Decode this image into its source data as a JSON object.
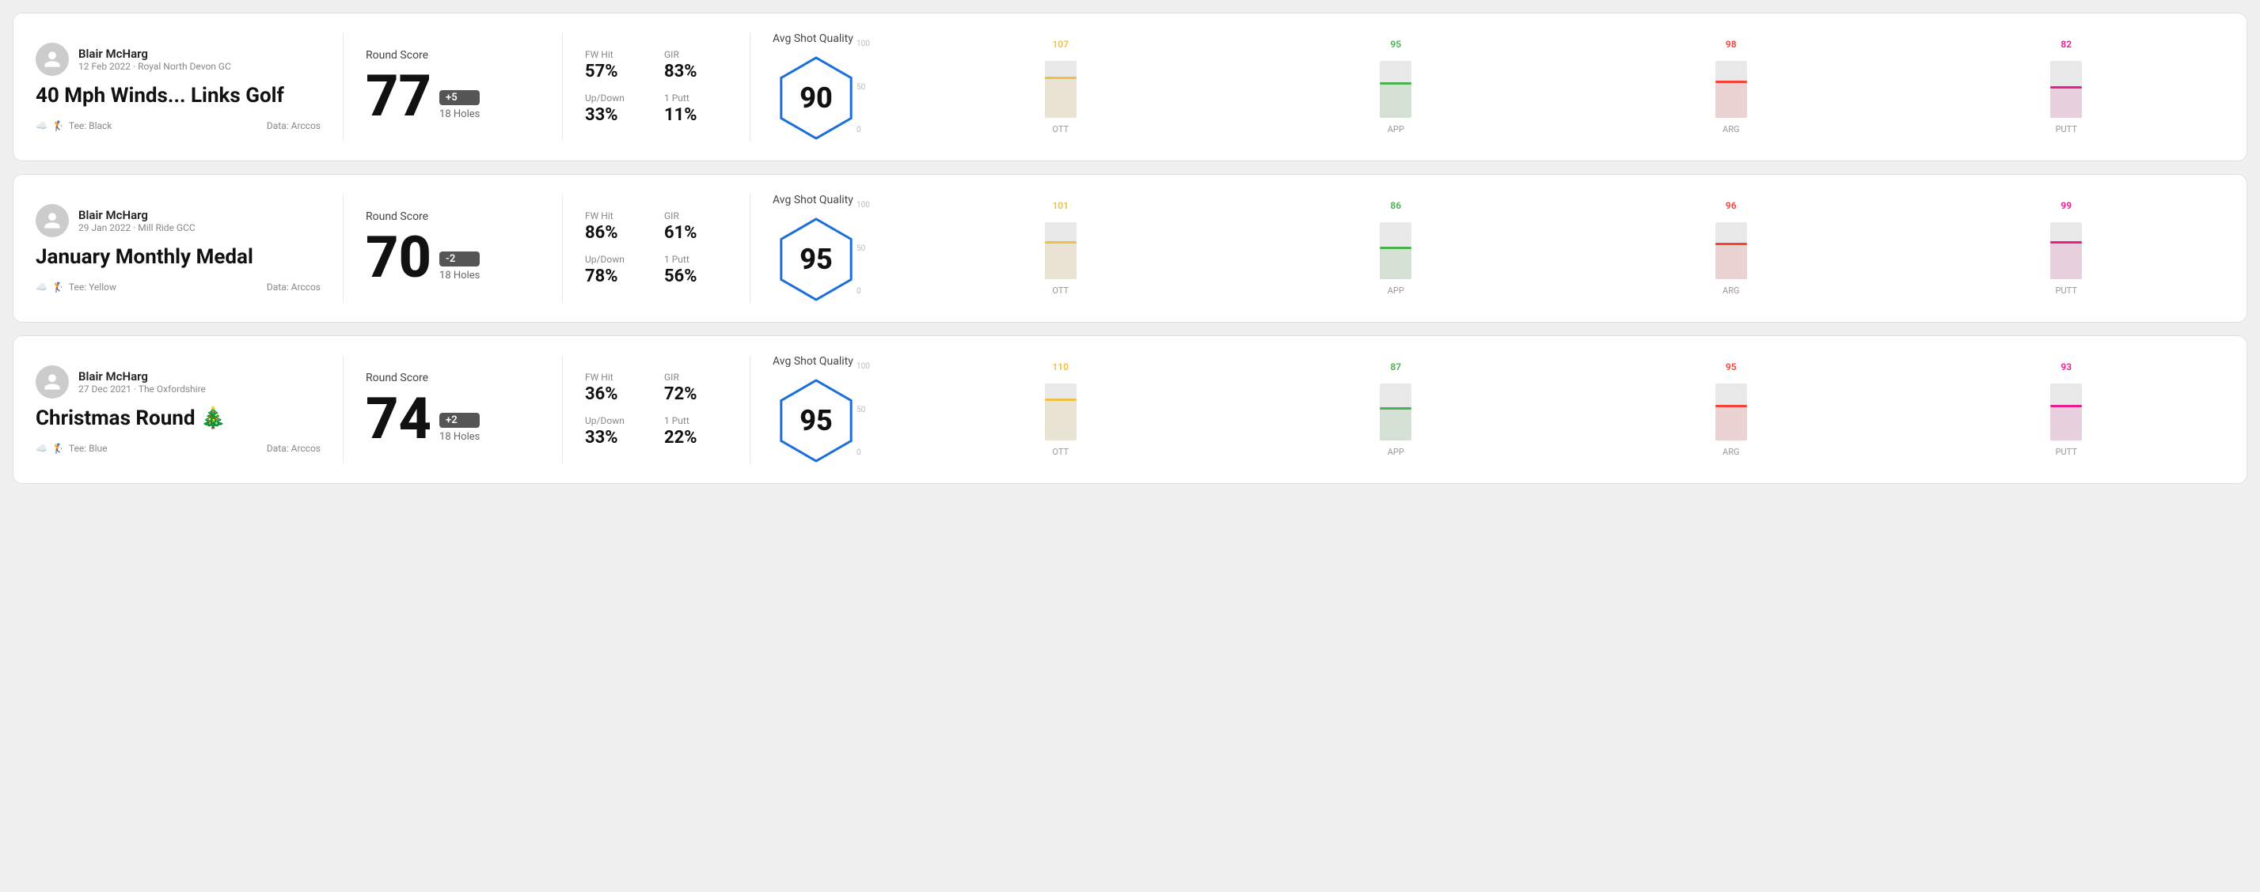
{
  "rounds": [
    {
      "user_name": "Blair McHarg",
      "user_meta": "12 Feb 2022 · Royal North Devon GC",
      "round_title": "40 Mph Winds... Links Golf",
      "round_title_emoji": "🏌️",
      "tee": "Black",
      "data_source": "Data: Arccos",
      "round_score_label": "Round Score",
      "score": "77",
      "score_diff": "+5",
      "holes": "18 Holes",
      "fw_hit_label": "FW Hit",
      "fw_hit": "57%",
      "gir_label": "GIR",
      "gir": "83%",
      "updown_label": "Up/Down",
      "updown": "33%",
      "oneputt_label": "1 Putt",
      "oneputt": "11%",
      "quality_label": "Avg Shot Quality",
      "quality_score": "90",
      "chart": {
        "columns": [
          {
            "label": "OTT",
            "top_value": "107",
            "top_color": "#f0c040",
            "fill_pct": 72,
            "fill_color": "#f0c040"
          },
          {
            "label": "APP",
            "top_value": "95",
            "top_color": "#4caf50",
            "fill_pct": 63,
            "fill_color": "#4caf50"
          },
          {
            "label": "ARG",
            "top_value": "98",
            "top_color": "#f44336",
            "fill_pct": 65,
            "fill_color": "#f44336"
          },
          {
            "label": "PUTT",
            "top_value": "82",
            "top_color": "#e91e8c",
            "fill_pct": 55,
            "fill_color": "#e91e8c"
          }
        ],
        "y_labels": [
          "100",
          "50",
          "0"
        ]
      }
    },
    {
      "user_name": "Blair McHarg",
      "user_meta": "29 Jan 2022 · Mill Ride GCC",
      "round_title": "January Monthly Medal",
      "round_title_emoji": "",
      "tee": "Yellow",
      "data_source": "Data: Arccos",
      "round_score_label": "Round Score",
      "score": "70",
      "score_diff": "-2",
      "holes": "18 Holes",
      "fw_hit_label": "FW Hit",
      "fw_hit": "86%",
      "gir_label": "GIR",
      "gir": "61%",
      "updown_label": "Up/Down",
      "updown": "78%",
      "oneputt_label": "1 Putt",
      "oneputt": "56%",
      "quality_label": "Avg Shot Quality",
      "quality_score": "95",
      "chart": {
        "columns": [
          {
            "label": "OTT",
            "top_value": "101",
            "top_color": "#f0c040",
            "fill_pct": 67,
            "fill_color": "#f0c040"
          },
          {
            "label": "APP",
            "top_value": "86",
            "top_color": "#4caf50",
            "fill_pct": 57,
            "fill_color": "#4caf50"
          },
          {
            "label": "ARG",
            "top_value": "96",
            "top_color": "#f44336",
            "fill_pct": 64,
            "fill_color": "#f44336"
          },
          {
            "label": "PUTT",
            "top_value": "99",
            "top_color": "#e91e8c",
            "fill_pct": 66,
            "fill_color": "#e91e8c"
          }
        ],
        "y_labels": [
          "100",
          "50",
          "0"
        ]
      }
    },
    {
      "user_name": "Blair McHarg",
      "user_meta": "27 Dec 2021 · The Oxfordshire",
      "round_title": "Christmas Round 🎄",
      "round_title_emoji": "",
      "tee": "Blue",
      "data_source": "Data: Arccos",
      "round_score_label": "Round Score",
      "score": "74",
      "score_diff": "+2",
      "holes": "18 Holes",
      "fw_hit_label": "FW Hit",
      "fw_hit": "36%",
      "gir_label": "GIR",
      "gir": "72%",
      "updown_label": "Up/Down",
      "updown": "33%",
      "oneputt_label": "1 Putt",
      "oneputt": "22%",
      "quality_label": "Avg Shot Quality",
      "quality_score": "95",
      "chart": {
        "columns": [
          {
            "label": "OTT",
            "top_value": "110",
            "top_color": "#f0c040",
            "fill_pct": 73,
            "fill_color": "#f0c040"
          },
          {
            "label": "APP",
            "top_value": "87",
            "top_color": "#4caf50",
            "fill_pct": 58,
            "fill_color": "#4caf50"
          },
          {
            "label": "ARG",
            "top_value": "95",
            "top_color": "#f44336",
            "fill_pct": 63,
            "fill_color": "#f44336"
          },
          {
            "label": "PUTT",
            "top_value": "93",
            "top_color": "#e91e8c",
            "fill_pct": 62,
            "fill_color": "#e91e8c"
          }
        ],
        "y_labels": [
          "100",
          "50",
          "0"
        ]
      }
    }
  ]
}
